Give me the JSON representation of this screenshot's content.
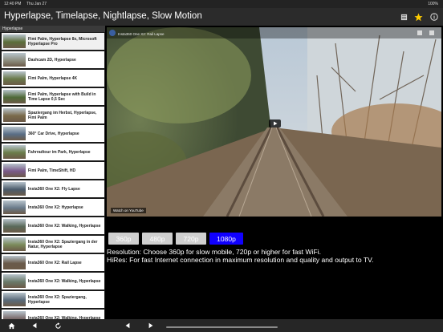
{
  "status_bar": {
    "time": "12:40 PM",
    "date": "Thu Jan 27",
    "right": "100%"
  },
  "nav": {
    "title": "Hyperlapse, Timelapse, Nightlapse, Slow Motion",
    "right_icons": [
      "book-icon",
      "star-icon",
      "info-icon"
    ],
    "star_color": "#ffcc00"
  },
  "sidebar": {
    "header": "Hyperlapse",
    "items": [
      {
        "label": "Fimi Palm, Hyperlapse 8x, Microsoft Hyperlapse Pro"
      },
      {
        "label": "Dashcam 2D, Hyperlapse"
      },
      {
        "label": "Fimi Palm, Hyperlapse 4K"
      },
      {
        "label": "Fimi Palm, Hyperlapse with Build in Time Lapse 0,5 Sec"
      },
      {
        "label": "Spaziergang im Herbst, Hyperlapse, Fimi Palm"
      },
      {
        "label": "360° Car Drive, Hyperlapse"
      },
      {
        "label": "Fahrradtour im Park, Hyperlapse"
      },
      {
        "label": "Fimi Palm, TimeShift, HD"
      },
      {
        "label": "Insta360 One X2: Fly Lapse"
      },
      {
        "label": "Insta360 One X2: Hyperlapse"
      },
      {
        "label": "Insta360 One X2: Walking, Hyperlapse"
      },
      {
        "label": "Insta360 One X2: Spaziergang in der Natur, Hyperlapse"
      },
      {
        "label": "Insta360 One X2: Rail Lapse"
      },
      {
        "label": "Insta360 One X2: Walking, Hyperlapse"
      },
      {
        "label": "Insta360 One X2: Spaziergang, Hyperlapse"
      },
      {
        "label": "Insta360 One X2: Walking, Hyperlapse"
      }
    ]
  },
  "video": {
    "title": "Insta360 One X2: Rail Lapse",
    "watch_on": "Watch on YouTube"
  },
  "resolution": {
    "options": [
      "360p",
      "480p",
      "720p",
      "1080p"
    ],
    "selected": "1080p",
    "selected_color": "#1000ff"
  },
  "info": {
    "line1": "Resolution: Choose 360p for slow mobile, 720p or higher for fast WiFi.",
    "line2": "HiRes: For fast Internet connection in maximum resolution and quality and output to TV."
  },
  "toolbar": {
    "icons": [
      "home-icon",
      "back-icon",
      "reload-icon",
      "prev-icon",
      "next-icon"
    ]
  }
}
